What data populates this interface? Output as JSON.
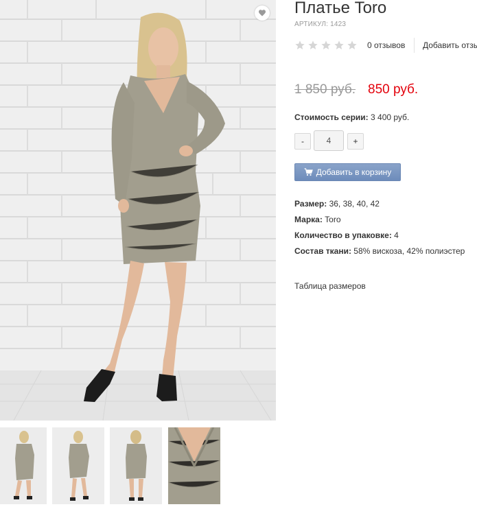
{
  "product": {
    "title": "Платье Toro",
    "sku": "АРТИКУЛ: 1423",
    "rating_stars": 0,
    "rating_max": 5,
    "reviews_label": "0 отзывов",
    "add_review_label": "Добавить отзыв",
    "old_price": "1 850 руб.",
    "new_price": "850 руб.",
    "series_label": "Стоимость серии:",
    "series_value": "3 400 руб.",
    "qty_minus": "-",
    "qty_value": "4",
    "qty_plus": "+",
    "cart_button": "Добавить в корзину",
    "size_table_link": "Таблица размеров"
  },
  "attributes": [
    {
      "label": "Размер:",
      "value": "36, 38, 40, 42"
    },
    {
      "label": "Марка:",
      "value": "Toro"
    },
    {
      "label": "Количество в упаковке:",
      "value": "4"
    },
    {
      "label": "Состав ткани:",
      "value": "58% вискоза, 42% полиэстер"
    }
  ],
  "icons": {
    "favorite": "heart-icon",
    "rating": "star-icon",
    "cart": "cart-icon"
  },
  "colors": {
    "price_new": "#e3000b",
    "price_old": "#999999",
    "cart_button": "#7592c1",
    "star_empty": "#d6d6d6"
  }
}
